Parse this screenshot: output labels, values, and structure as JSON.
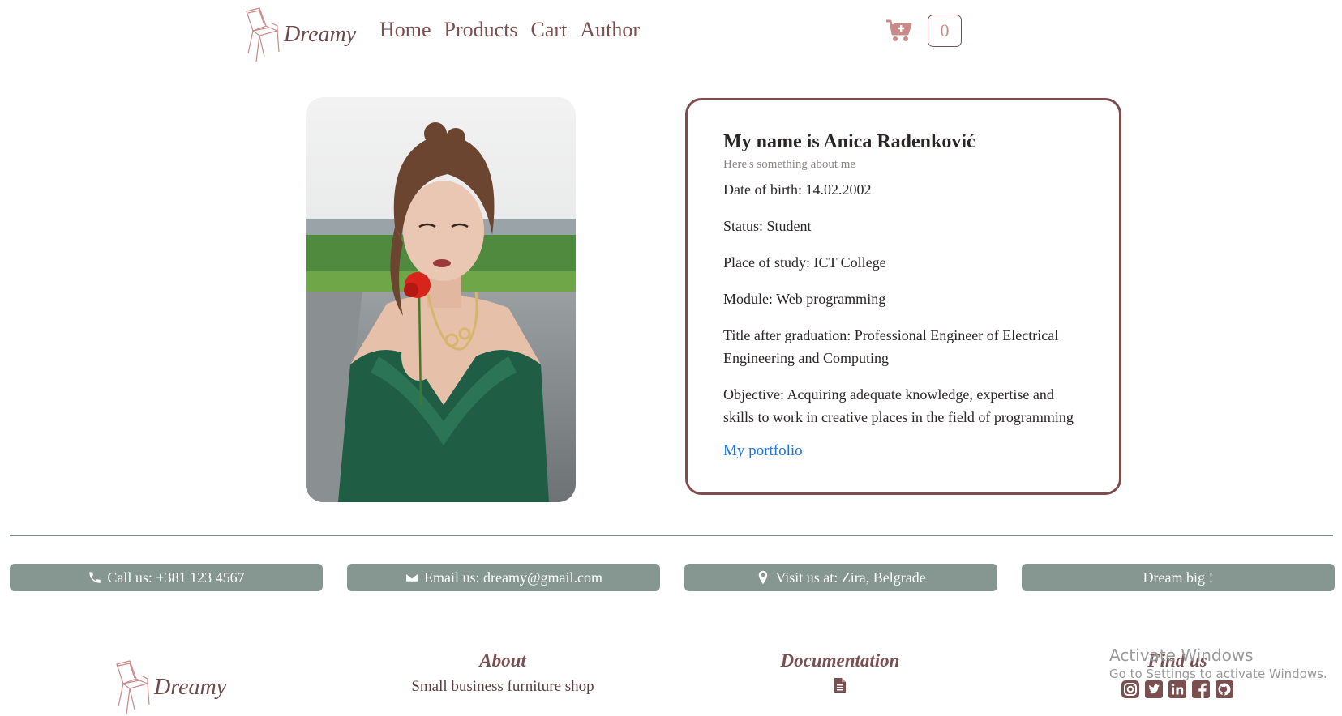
{
  "nav": {
    "logo_text": "Dreamy",
    "links": [
      "Home",
      "Products",
      "Cart",
      "Author"
    ],
    "cart_count": "0"
  },
  "profile": {
    "name": "My name is Anica Radenković",
    "subtitle": "Here's something about me",
    "details": [
      "Date of birth: 14.02.2002",
      "Status: Student",
      "Place of study: ICT College",
      "Module: Web programming",
      "Title after graduation: Professional Engineer of Electrical Engineering and Computing",
      "Objective: Acquiring adequate knowledge, expertise and skills to work in creative places in the field of programming"
    ],
    "portfolio_link": "My portfolio"
  },
  "contact": [
    {
      "icon": "phone-icon",
      "label": "Call us: +381 123 4567"
    },
    {
      "icon": "envelope-icon",
      "label": "Email us: dreamy@gmail.com"
    },
    {
      "icon": "map-marker-icon",
      "label": "Visit us at: Zira, Belgrade"
    },
    {
      "icon": "",
      "label": "Dream big !"
    }
  ],
  "footer": {
    "logo_text": "Dreamy",
    "about_title": "About",
    "about_text": "Small business furniture shop",
    "doc_title": "Documentation",
    "find_title": "Find us",
    "social_icons": [
      "instagram-icon",
      "twitter-icon",
      "linkedin-icon",
      "facebook-icon",
      "github-icon"
    ]
  },
  "watermark": {
    "line1": "Activate Windows",
    "line2": "Go to Settings to activate Windows."
  },
  "colors": {
    "brand": "#7a4f4f",
    "button_bg": "#869690",
    "link": "#1a73e8",
    "cart_icon": "#c98a88"
  }
}
